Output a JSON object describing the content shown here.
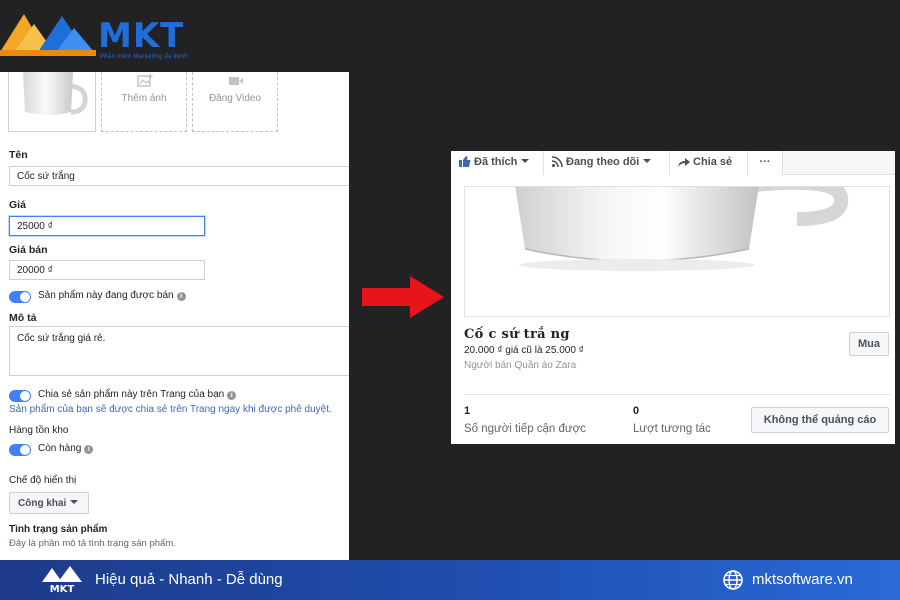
{
  "brand": {
    "name": "MKT",
    "tagline": "Phần mềm Marketing đa kênh"
  },
  "form": {
    "media": {
      "add_photo": "Thêm ảnh",
      "add_video": "Đăng Video"
    },
    "name": {
      "label": "Tên",
      "value": "Cốc sứ trắng"
    },
    "price": {
      "label": "Giá",
      "value": "25000 ₫"
    },
    "sale_price": {
      "label": "Giá bán",
      "value": "20000 ₫"
    },
    "on_sale_toggle": "Sản phẩm này đang được bán",
    "description": {
      "label": "Mô tả",
      "value": "Cốc sứ trắng giá rẻ."
    },
    "share_toggle": "Chia sẻ sản phẩm này trên Trang của bạn",
    "share_note": "Sản phẩm của bạn sẽ được chia sẻ trên Trang ngay khi được phê duyệt.",
    "inventory": {
      "label": "Hàng tồn kho",
      "toggle": "Còn hàng"
    },
    "visibility": {
      "label": "Chế độ hiển thị",
      "value": "Công khai"
    },
    "condition": {
      "label": "Tình trạng sản phẩm",
      "note": "Đây là phần mô tả tình trạng sản phẩm."
    }
  },
  "preview": {
    "tabs": {
      "liked": "Đã thích",
      "following": "Đang theo dõi",
      "share": "Chia sẻ",
      "more": "···"
    },
    "title": "Cố c sứ trắ ng",
    "price_line": "20.000 ₫ giá cũ là 25.000 ₫",
    "seller": "Người bán Quần áo Zara",
    "buy": "Mua",
    "reach": {
      "value": "1",
      "label": "Số người tiếp cận được"
    },
    "engagement": {
      "value": "0",
      "label": "Lượt tương tác"
    },
    "cannot_boost": "Không thể quảng cáo"
  },
  "footer": {
    "slogan": "Hiệu quả - Nhanh - Dễ dùng",
    "website": "mktsoftware.vn"
  },
  "colors": {
    "accent": "#4080ff",
    "footer": "#1f4fb0",
    "arrow": "#e8141b",
    "logo": "#1e6fd9"
  }
}
